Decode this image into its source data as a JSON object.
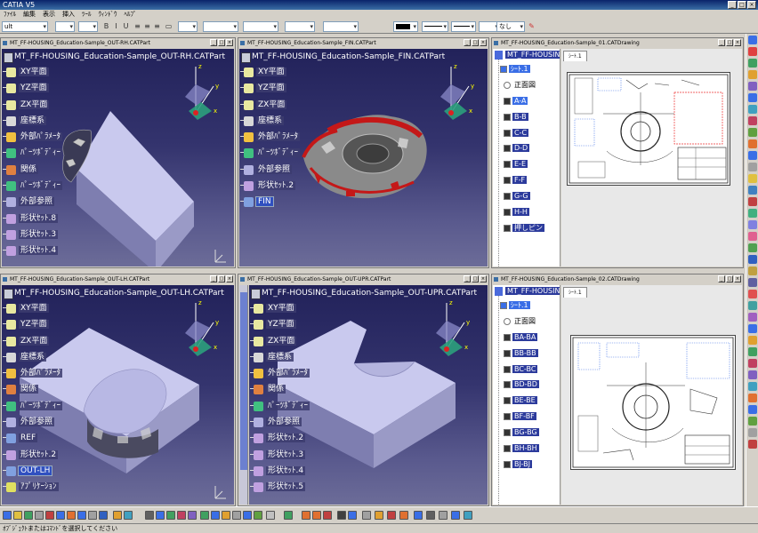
{
  "app": {
    "title": "CATIA V5"
  },
  "menu": [
    "ﾌｧｲﾙ",
    "編集",
    "表示",
    "挿入",
    "ﾂｰﾙ",
    "ｳｨﾝﾄﾞｳ",
    "ﾍﾙﾌﾟ"
  ],
  "propbar": {
    "style_value": "ult",
    "line_value": "なし"
  },
  "statusbar": {
    "text": "ｵﾌﾞｼﾞｪｸﾄまたはｺﾏﾝﾄﾞを選択してください"
  },
  "windows": [
    {
      "title": "MT_FF-HOUSING_Education-Sample_OUT-RH.CATPart",
      "root": "MT_FF-HOUSING_Education-Sample_OUT-RH.CATPart",
      "items": [
        {
          "label": "XY平面",
          "icon": "plane-icon"
        },
        {
          "label": "YZ平面",
          "icon": "plane-icon"
        },
        {
          "label": "ZX平面",
          "icon": "plane-icon"
        },
        {
          "label": "座標系",
          "icon": "axis-system-icon"
        },
        {
          "label": "外部ﾊﾟﾗﾒｰﾀ",
          "icon": "parameters-icon"
        },
        {
          "label": "ﾊﾟｰﾂﾎﾞﾃﾞｨｰ",
          "icon": "part-body-icon"
        },
        {
          "label": "関係",
          "icon": "relations-icon"
        },
        {
          "label": "ﾊﾟｰﾂﾎﾞﾃﾞｨｰ",
          "icon": "part-body-icon"
        },
        {
          "label": "外部参照",
          "icon": "external-reference-icon"
        },
        {
          "label": "形状ｾｯﾄ.8",
          "icon": "geometrical-set-icon"
        },
        {
          "label": "形状ｾｯﾄ.3",
          "icon": "geometrical-set-icon"
        },
        {
          "label": "形状ｾｯﾄ.4",
          "icon": "geometrical-set-icon"
        }
      ]
    },
    {
      "title": "MT_FF-HOUSING_Education-Sample_FIN.CATPart",
      "root": "MT_FF-HOUSING_Education-Sample_FIN.CATPart",
      "items": [
        {
          "label": "XY平面",
          "icon": "plane-icon"
        },
        {
          "label": "YZ平面",
          "icon": "plane-icon"
        },
        {
          "label": "ZX平面",
          "icon": "plane-icon"
        },
        {
          "label": "座標系",
          "icon": "axis-system-icon"
        },
        {
          "label": "外部ﾊﾟﾗﾒｰﾀ",
          "icon": "parameters-icon"
        },
        {
          "label": "ﾊﾟｰﾂﾎﾞﾃﾞｨｰ",
          "icon": "part-body-icon"
        },
        {
          "label": "外部参照",
          "icon": "external-reference-icon"
        },
        {
          "label": "形状ｾｯﾄ.2",
          "icon": "geometrical-set-icon"
        },
        {
          "label": "FIN",
          "icon": "body-icon"
        }
      ]
    },
    {
      "title": "MT_FF-HOUSING_Education-Sample_01.CATDrawing",
      "root": "MT_FF-HOUSING_",
      "sheet": "ｼｰﾄ.1",
      "tab": "ｼｰﾄ.1",
      "views": [
        "正面図",
        "A-A",
        "B-B",
        "C-C",
        "D-D",
        "E-E",
        "F-F",
        "G-G",
        "H-H",
        "押しピン"
      ]
    },
    {
      "title": "MT_FF-HOUSING_Education-Sample_OUT-LH.CATPart",
      "root": "MT_FF-HOUSING_Education-Sample_OUT-LH.CATPart",
      "items": [
        {
          "label": "XY平面",
          "icon": "plane-icon"
        },
        {
          "label": "YZ平面",
          "icon": "plane-icon"
        },
        {
          "label": "ZX平面",
          "icon": "plane-icon"
        },
        {
          "label": "座標系",
          "icon": "axis-system-icon"
        },
        {
          "label": "外部ﾊﾟﾗﾒｰﾀ",
          "icon": "parameters-icon"
        },
        {
          "label": "関係",
          "icon": "relations-icon"
        },
        {
          "label": "ﾊﾟｰﾂﾎﾞﾃﾞｨｰ",
          "icon": "part-body-icon"
        },
        {
          "label": "外部参照",
          "icon": "external-reference-icon"
        },
        {
          "label": "REF",
          "icon": "body-icon"
        },
        {
          "label": "形状ｾｯﾄ.2",
          "icon": "geometrical-set-icon"
        },
        {
          "label": "OUT-LH",
          "icon": "body-icon"
        },
        {
          "label": "ｱﾌﾟﾘｹｰｼｮﾝ",
          "icon": "applications-icon"
        }
      ]
    },
    {
      "title": "MT_FF-HOUSING_Education-Sample_OUT-UPR.CATPart",
      "root": "MT_FF-HOUSING_Education-Sample_OUT-UPR.CATPart",
      "items": [
        {
          "label": "XY平面",
          "icon": "plane-icon"
        },
        {
          "label": "YZ平面",
          "icon": "plane-icon"
        },
        {
          "label": "ZX平面",
          "icon": "plane-icon"
        },
        {
          "label": "座標系",
          "icon": "axis-system-icon"
        },
        {
          "label": "外部ﾊﾟﾗﾒｰﾀ",
          "icon": "parameters-icon"
        },
        {
          "label": "関係",
          "icon": "relations-icon"
        },
        {
          "label": "ﾊﾟｰﾂﾎﾞﾃﾞｨｰ",
          "icon": "part-body-icon"
        },
        {
          "label": "外部参照",
          "icon": "external-reference-icon"
        },
        {
          "label": "形状ｾｯﾄ.2",
          "icon": "geometrical-set-icon"
        },
        {
          "label": "形状ｾｯﾄ.3",
          "icon": "geometrical-set-icon"
        },
        {
          "label": "形状ｾｯﾄ.4",
          "icon": "geometrical-set-icon"
        },
        {
          "label": "形状ｾｯﾄ.5",
          "icon": "geometrical-set-icon"
        }
      ]
    },
    {
      "title": "MT_FF-HOUSING_Education-Sample_02.CATDrawing",
      "root": "MT_FF-HOUSING_",
      "sheet": "ｼｰﾄ.1",
      "tab": "ｼｰﾄ.1",
      "views": [
        "正面図",
        "BA-BA",
        "BB-BB",
        "BC-BC",
        "BD-BD",
        "BE-BE",
        "BF-BF",
        "BG-BG",
        "BH-BH",
        "BJ-BJ"
      ]
    }
  ],
  "colors": {
    "viewport_top": "#22225a",
    "viewport_bottom": "#6c6c98",
    "selection": "#3050c0",
    "part_face": "#c8c8ee",
    "fin_red": "#c41818"
  },
  "axis": {
    "x": "x",
    "y": "y",
    "z": "z"
  }
}
